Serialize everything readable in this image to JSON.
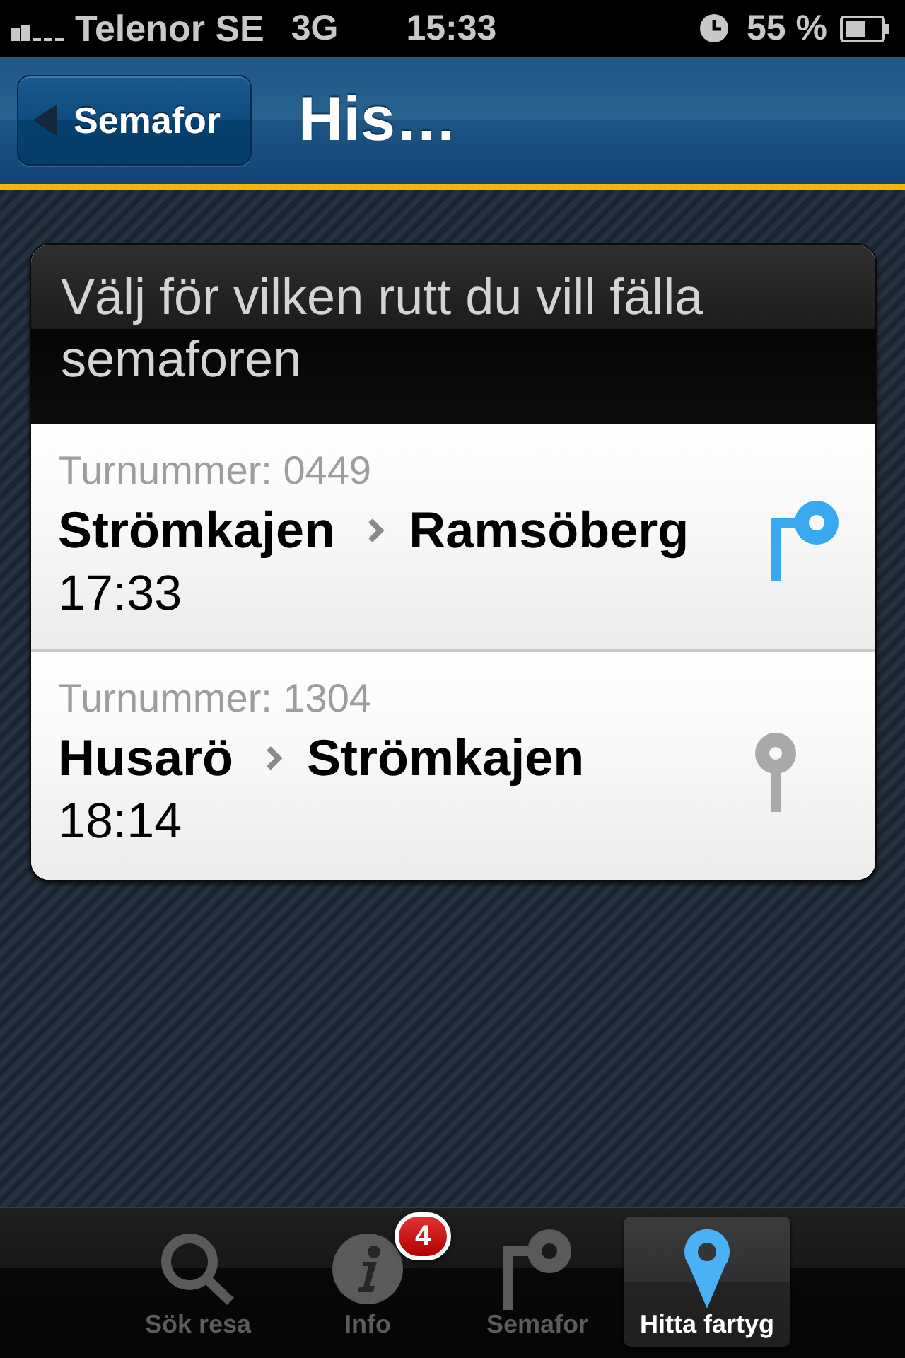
{
  "status_bar": {
    "carrier": "Telenor SE",
    "network": "3G",
    "time": "15:33",
    "battery": "55 %"
  },
  "nav_bar": {
    "back_button": "Semafor",
    "title": "His…"
  },
  "card": {
    "header": "Välj för vilken rutt du vill fälla semaforen",
    "routes": [
      {
        "turn_number": "Turnummer: 0449",
        "from": "Strömkajen",
        "to": "Ramsöberg",
        "time": "17:33",
        "active": true
      },
      {
        "turn_number": "Turnummer: 1304",
        "from": "Husarö",
        "to": "Strömkajen",
        "time": "18:14",
        "active": false
      }
    ]
  },
  "tab_bar": {
    "items": [
      {
        "label": "Sök resa",
        "kind": "search",
        "selected": false
      },
      {
        "label": "Info",
        "kind": "info",
        "badge": "4",
        "selected": false
      },
      {
        "label": "Semafor",
        "kind": "semaphore",
        "selected": false
      },
      {
        "label": "Hitta fartyg",
        "kind": "pin",
        "selected": true
      }
    ]
  }
}
